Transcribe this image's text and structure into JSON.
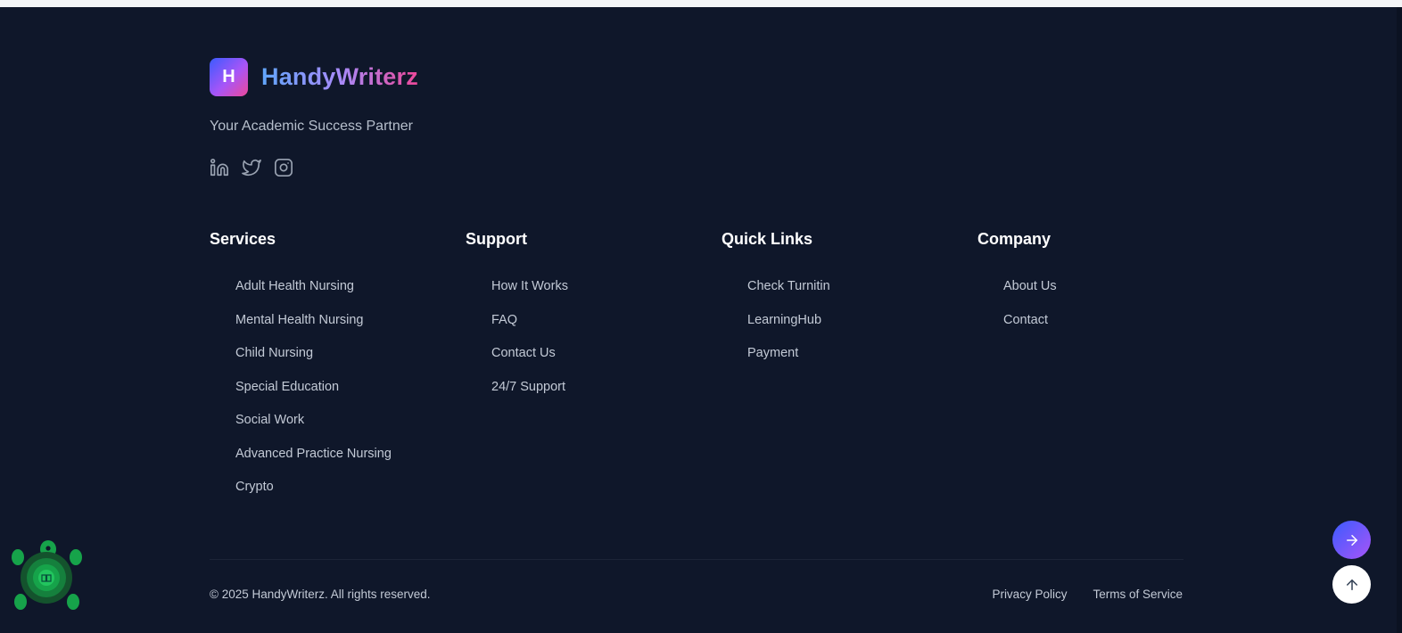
{
  "brand": {
    "logo_letter": "H",
    "name": "HandyWriterz",
    "tagline": "Your Academic Success Partner"
  },
  "socials": [
    {
      "icon": "linkedin-icon"
    },
    {
      "icon": "twitter-icon"
    },
    {
      "icon": "instagram-icon"
    }
  ],
  "columns": {
    "services": {
      "title": "Services",
      "items": [
        "Adult Health Nursing",
        "Mental Health Nursing",
        "Child Nursing",
        "Special Education",
        "Social Work",
        "Advanced Practice Nursing",
        "Crypto"
      ]
    },
    "support": {
      "title": "Support",
      "items": [
        "How It Works",
        "FAQ",
        "Contact Us",
        "24/7 Support"
      ]
    },
    "quick_links": {
      "title": "Quick Links",
      "items": [
        "Check Turnitin",
        "LearningHub",
        "Payment"
      ]
    },
    "company": {
      "title": "Company",
      "items": [
        "About Us",
        "Contact"
      ]
    }
  },
  "bottom": {
    "copyright": "© 2025 HandyWriterz. All rights reserved.",
    "privacy": "Privacy Policy",
    "terms": "Terms of Service"
  },
  "colors": {
    "background": "#0f172a",
    "accent_blue": "#3b5bff",
    "accent_purple": "#a855f7",
    "accent_pink": "#ec4899",
    "link_text": "#c3cad6",
    "turtle_green": "#22c55e"
  },
  "floating": {
    "next_icon": "arrow-right-icon",
    "top_icon": "arrow-up-icon",
    "widget_icon": "turtle-book-icon"
  }
}
